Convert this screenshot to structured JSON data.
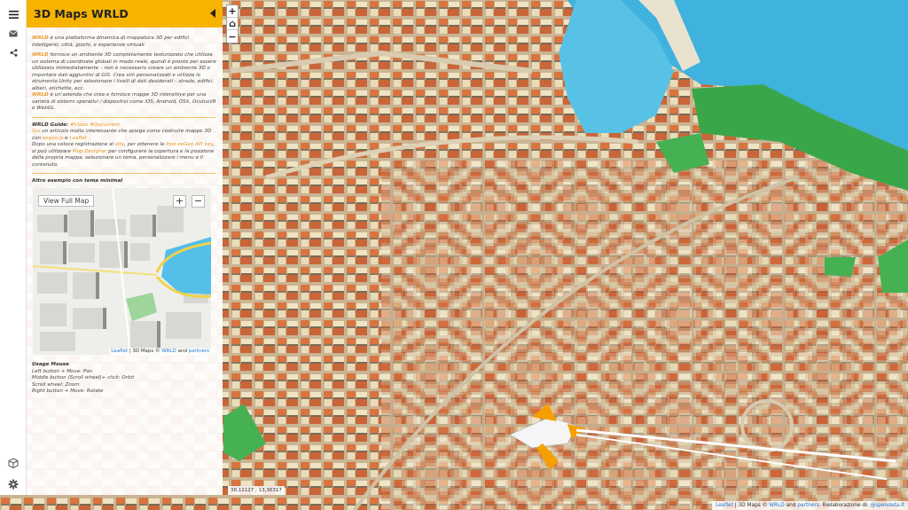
{
  "app": {
    "title": "3D Maps WRLD"
  },
  "sidebar_icons": [
    "menu-icon",
    "mail-icon",
    "share-icon"
  ],
  "intro": {
    "p1_brand": "WRLD",
    "p1_text": " è una piattaforma dinamica di mappatura 3D per edifici intelligenti, città, giochi, e esperienze virtuali.",
    "p2_brand": "WRLD",
    "p2_text": " fornisce un ambiente 3D completamente testurizzato che utilizza un sistema di coordinate globali in modo reale, quindi è pronto per essere utilizzato immediatamente – non è necessario creare un ambiente 3D o importare dati aggiuntivi di GIS. Crea stili personalizzati e utilizza lo strumento Unity per selezionare i livelli di dati desiderati – strade, edifici, alberi, etichette, ecc.",
    "p3_brand": "WRLD",
    "p3_text": " è un'azienda che crea e fornisce mappe 3D interattive per una varietà di sistemi operativi / dispositivi come iOS, Android, OSX, OculusVR e WebGL."
  },
  "guide": {
    "label": "WRLD Guide:",
    "links": "#Video #Document",
    "qui": "Qui",
    "text_a": " un articolo molto interessante che spiega come costruire mappe 3D con ",
    "eegeo": "eegeo.js",
    "e": " e ",
    "leaflet": "Leaflet",
    "text_b": "Dopo una veloce registrazione al ",
    "sito": "sito",
    "text_c": ", per ottenere le ",
    "apikey": "free eeGeo API key",
    "text_d": ", si può utilizzare ",
    "designer": "Map Designer",
    "text_e": " per configurare la copertura e la posizione della propria mappa, selezionare un tema, personalizzare i menu e il contenuto."
  },
  "example": {
    "title": "Altro esempio con tema minimal",
    "view_full_map": "View Full Map",
    "zoom_in": "+",
    "zoom_out": "−",
    "attr_leaflet": "Leaflet",
    "attr_mid": " | 3D Maps © ",
    "attr_wrld": "WRLD",
    "attr_and": " and ",
    "attr_partners": "partners"
  },
  "usage": {
    "title": "Usage Mouse",
    "lines": [
      "Left button + Move: Pan",
      "Middle button (Scroll wheel)+ click: Orbit",
      "Scroll wheel: Zoom",
      "Right button + Move: Rotate"
    ]
  },
  "map_controls": {
    "zoom_in": "+",
    "home": "⌂",
    "zoom_out": "−"
  },
  "coords": "38,11127 ; 13,36317",
  "attribution": {
    "leaflet": "Leaflet",
    "mid": " | 3D Maps © ",
    "wrld": "WRLD",
    "and": " and ",
    "partners": "partners",
    "rielab": ". Rielaborazione di: ",
    "author": "@spendata.it"
  },
  "colors": {
    "accent": "#f6b300",
    "link": "#e8962a",
    "sea": "#3fb3dd",
    "park": "#3aa64a"
  }
}
